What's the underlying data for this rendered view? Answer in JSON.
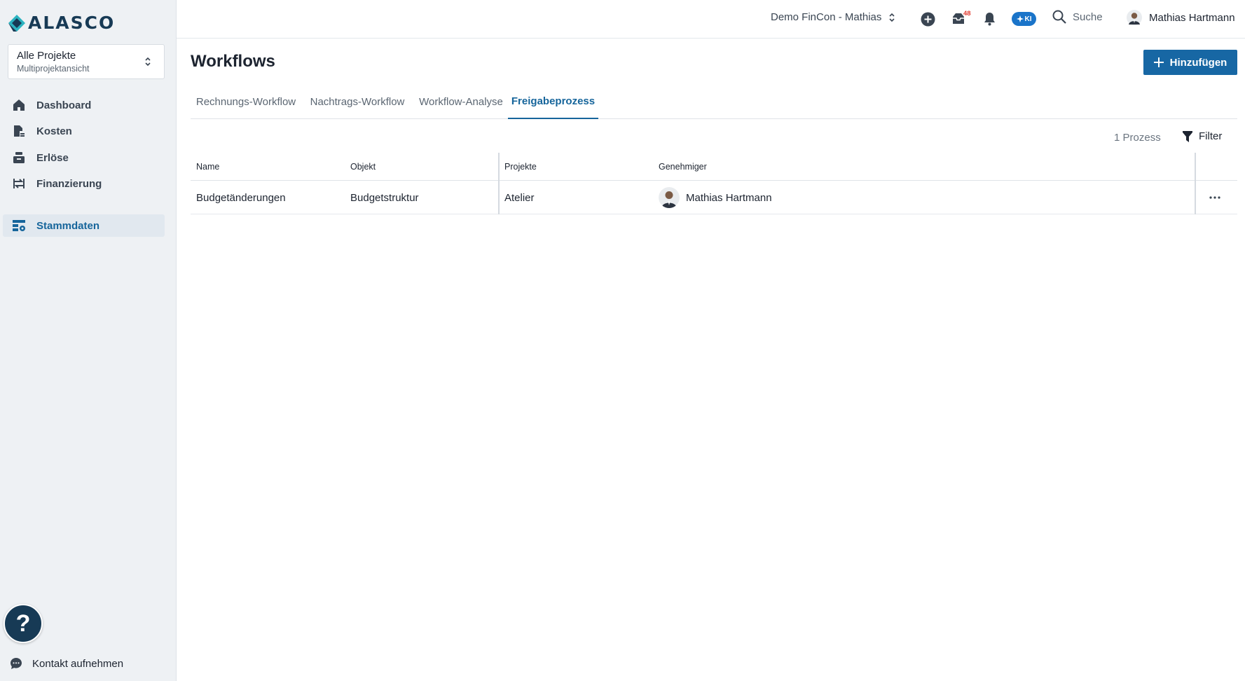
{
  "brand": {
    "name": "ALASCO"
  },
  "project_select": {
    "title": "Alle Projekte",
    "subtitle": "Multiprojektansicht"
  },
  "sidebar": {
    "items": [
      {
        "label": "Dashboard",
        "icon": "home-icon"
      },
      {
        "label": "Kosten",
        "icon": "cost-icon"
      },
      {
        "label": "Erlöse",
        "icon": "revenue-icon"
      },
      {
        "label": "Finanzierung",
        "icon": "financing-icon"
      },
      {
        "label": "Stammdaten",
        "icon": "master-data-icon",
        "active": true
      }
    ],
    "contact_label": "Kontakt aufnehmen",
    "help_label": "?"
  },
  "topbar": {
    "company": "Demo FinCon - Mathias",
    "inbox_badge": "48",
    "ki_label": "KI",
    "search_label": "Suche",
    "user_name": "Mathias Hartmann"
  },
  "page": {
    "title": "Workflows",
    "add_button": "Hinzufügen",
    "tabs": [
      {
        "label": "Rechnungs-Workflow",
        "active": false
      },
      {
        "label": "Nachtrags-Workflow",
        "active": false
      },
      {
        "label": "Workflow-Analyse",
        "active": false
      },
      {
        "label": "Freigabeprozess",
        "active": true
      }
    ],
    "count_label": "1 Prozess",
    "filter_label": "Filter"
  },
  "table": {
    "columns": [
      "Name",
      "Objekt",
      "Projekte",
      "Genehmiger"
    ],
    "rows": [
      {
        "name": "Budgetänderungen",
        "object": "Budgetstruktur",
        "projects": "Atelier",
        "approver": "Mathias Hartmann"
      }
    ]
  },
  "colors": {
    "accent": "#16659b",
    "brand_dark": "#173a55",
    "button": "#1767a4",
    "badge": "#e0392f"
  }
}
